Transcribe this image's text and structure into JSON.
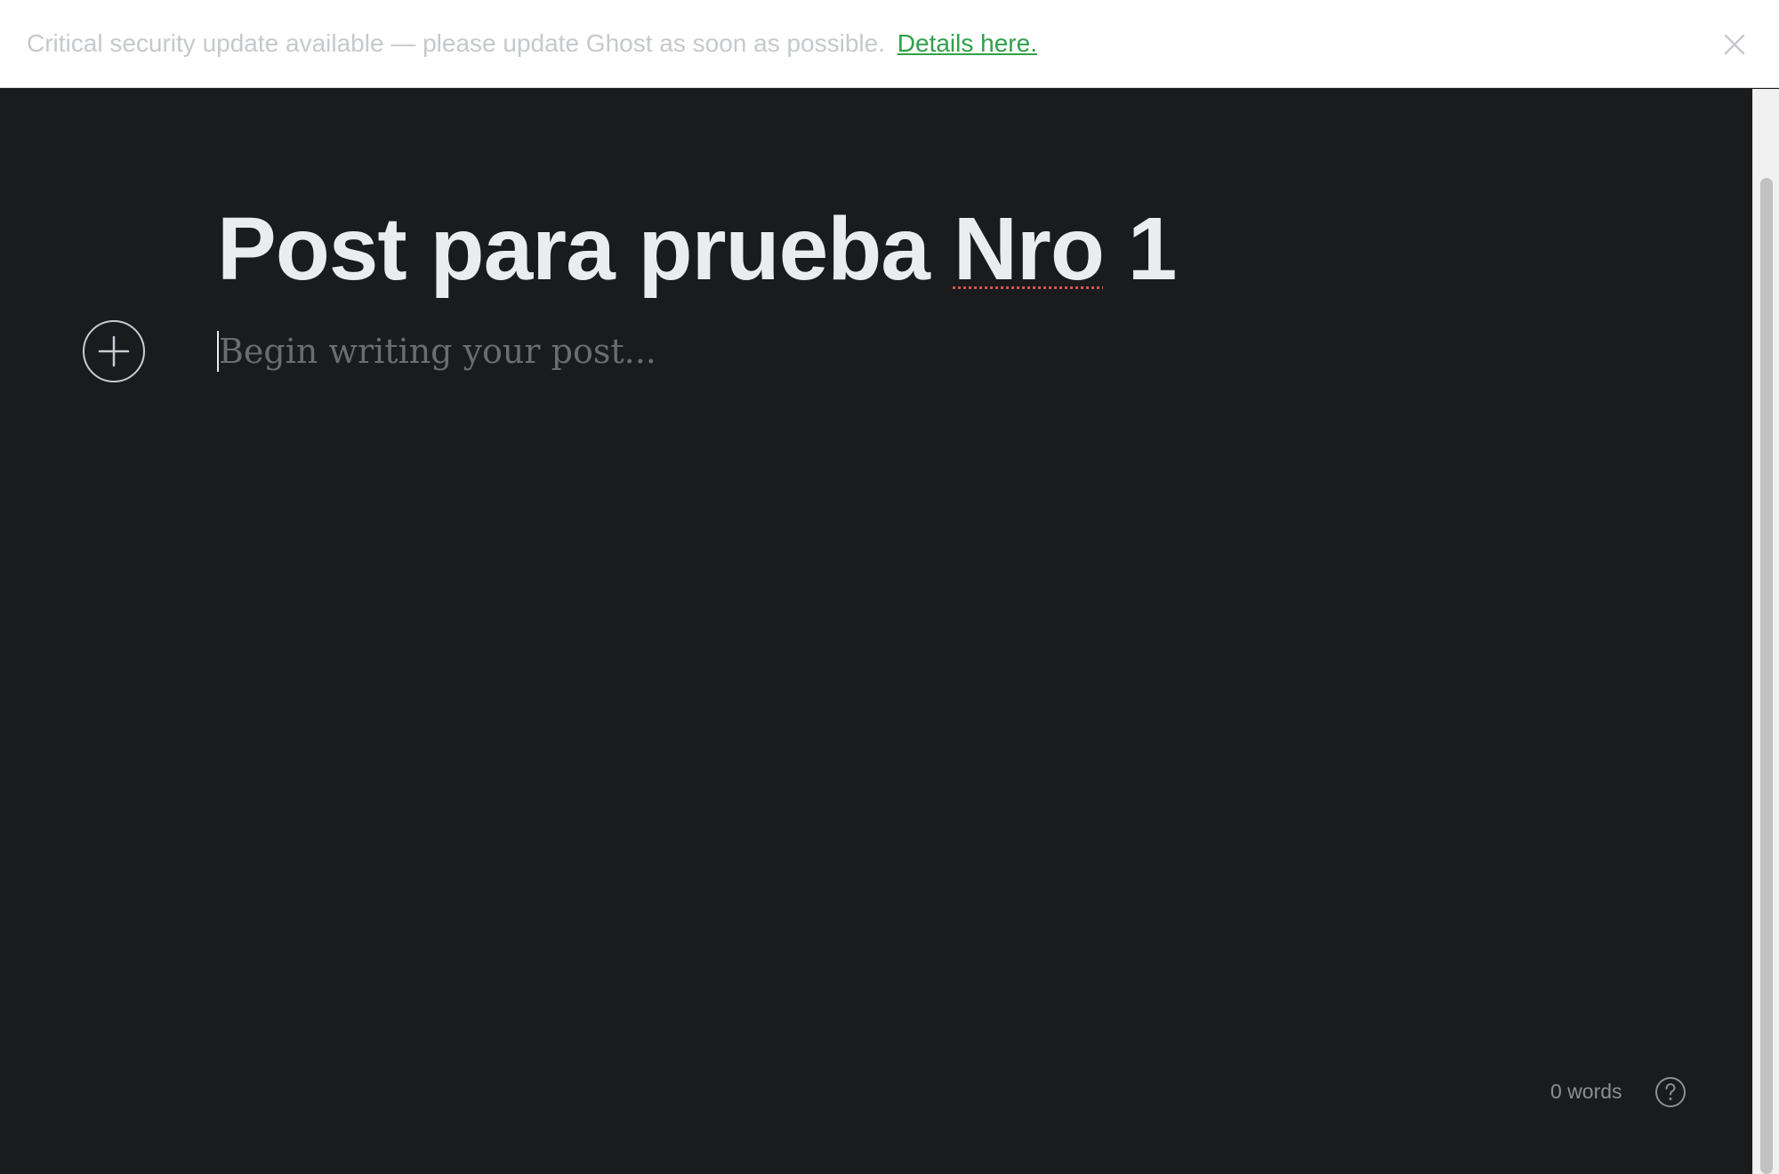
{
  "banner": {
    "message": "Critical security update available — please update Ghost as soon as possible.",
    "link_label": "Details here.",
    "close_icon": "close-icon"
  },
  "editor": {
    "title": "Post para prueba Nro 1",
    "title_parts": {
      "before": "Post para prueba ",
      "misspelled": "Nro",
      "after": " 1"
    },
    "body_placeholder": "Begin writing your post...",
    "add_card_icon": "plus-icon",
    "word_count": "0 words",
    "help_icon": "question-mark-icon"
  },
  "colors": {
    "background": "#191b1d",
    "title": "#eaedf0",
    "placeholder": "#6a6d70",
    "link": "#30a04b",
    "spellcheck": "#d9534f"
  }
}
